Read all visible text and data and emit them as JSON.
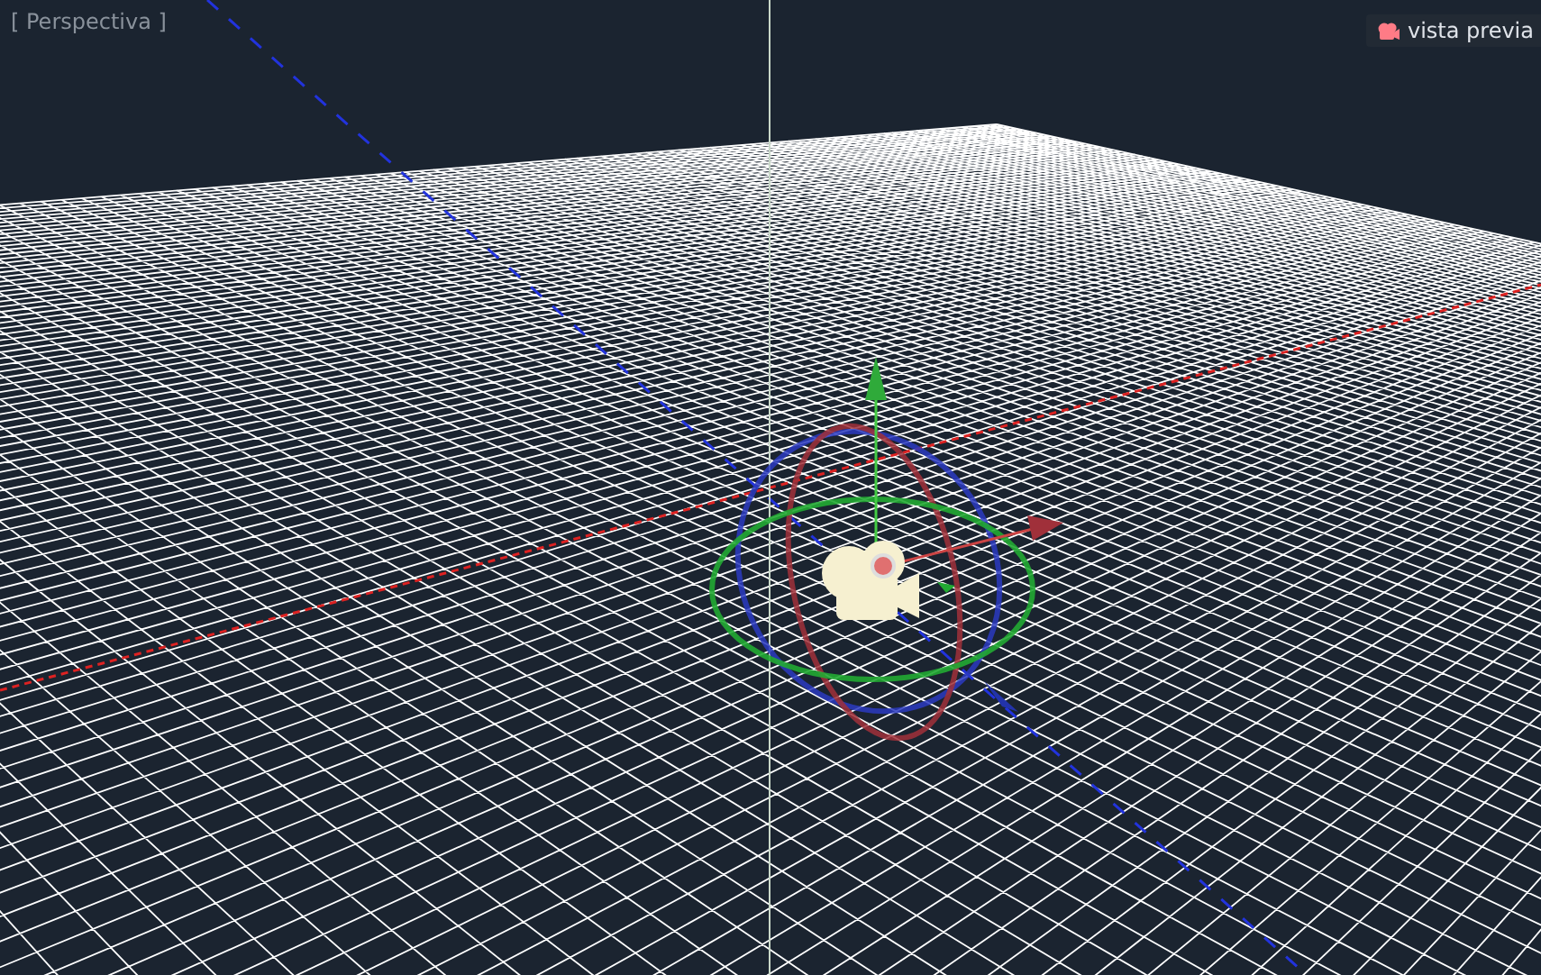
{
  "viewport": {
    "label": "[ Perspectiva ]"
  },
  "preview_button": {
    "label": "vista previa"
  }
}
